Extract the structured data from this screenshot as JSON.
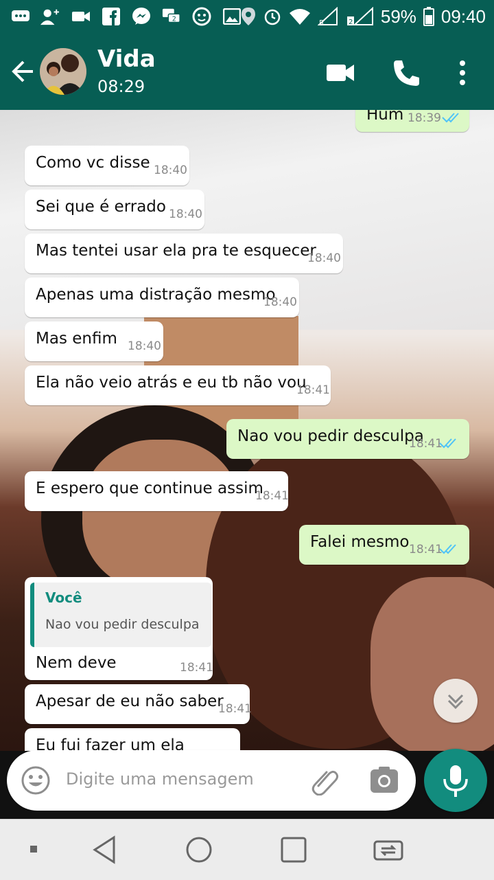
{
  "status_bar": {
    "battery_percent": "59%",
    "time": "09:40",
    "icons": [
      "message-icon",
      "add-contact-icon",
      "video-icon",
      "facebook-icon",
      "messenger-icon",
      "chat-2-icon",
      "android-icon",
      "image-icon",
      "location-icon",
      "alarm-icon",
      "wifi-icon",
      "signal-1-icon",
      "signal-2-icon",
      "battery-icon"
    ]
  },
  "header": {
    "contact_name": "Vida",
    "last_seen": "08:29"
  },
  "messages": [
    {
      "dir": "out",
      "text": "Hum",
      "time": "18:39",
      "read": true
    },
    {
      "dir": "in",
      "text": "Como vc disse",
      "time": "18:40"
    },
    {
      "dir": "in",
      "text": "Sei que é errado",
      "time": "18:40"
    },
    {
      "dir": "in",
      "text": "Mas tentei usar ela pra te esquecer",
      "time": "18:40"
    },
    {
      "dir": "in",
      "text": "Apenas uma distração mesmo",
      "time": "18:40"
    },
    {
      "dir": "in",
      "text": "Mas enfim",
      "time": "18:40"
    },
    {
      "dir": "in",
      "text": "Ela não veio atrás e eu tb não vou",
      "time": "18:41"
    },
    {
      "dir": "out",
      "text": "Nao vou pedir desculpa",
      "time": "18:41",
      "read": true
    },
    {
      "dir": "in",
      "text": "E espero que continue assim",
      "time": "18:41"
    },
    {
      "dir": "out",
      "text": "Falei mesmo",
      "time": "18:41",
      "read": true
    },
    {
      "dir": "in",
      "text": "Nem deve",
      "time": "18:41",
      "quote": {
        "author": "Você",
        "text": "Nao vou pedir desculpa"
      }
    },
    {
      "dir": "in",
      "text": "Apesar de eu não saber",
      "time": "18:41"
    },
    {
      "dir": "in",
      "text": "Eu fui fazer um ela",
      "time": ""
    }
  ],
  "composer": {
    "placeholder": "Digite uma mensagem"
  },
  "colors": {
    "primary": "#075e54",
    "accent": "#128c7e",
    "outgoing_bubble": "#dcf8c6",
    "incoming_bubble": "#ffffff",
    "read_ticks": "#4fc3f7"
  }
}
